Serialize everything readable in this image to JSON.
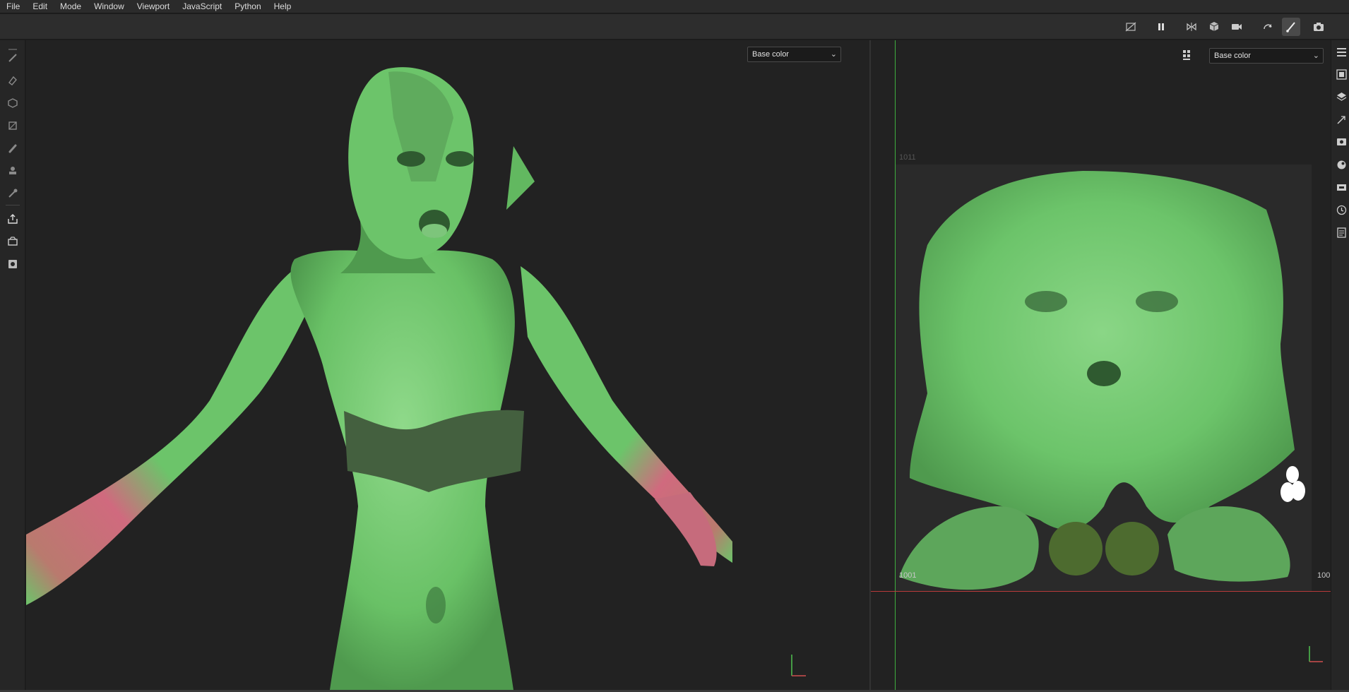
{
  "menu": {
    "items": [
      "File",
      "Edit",
      "Mode",
      "Window",
      "Viewport",
      "JavaScript",
      "Python",
      "Help"
    ]
  },
  "toolbar": {
    "icons": [
      "hide-ui-icon",
      "pause-icon",
      "symmetry-icon",
      "cube-icon",
      "camera-icon",
      "rotate-icon",
      "paint-brush-icon",
      "screenshot-icon"
    ]
  },
  "left_tools": [
    "paint-icon",
    "eraser-icon",
    "projection-icon",
    "polygon-fill-icon",
    "smudge-icon",
    "clone-icon",
    "color-picker-icon",
    "export-icon",
    "bake-icon",
    "render-icon"
  ],
  "right_tools": [
    "layers-list-icon",
    "texture-set-icon",
    "layers-icon",
    "properties-icon",
    "display-settings-icon",
    "shader-icon",
    "shelf-icon",
    "history-icon",
    "log-icon"
  ],
  "viewport3d": {
    "channel_select": "Base color"
  },
  "viewport2d": {
    "channel_select": "Base color",
    "uv_tile_top": "1011",
    "uv_tile_bottom": "1001",
    "uv_tile_right": "100"
  },
  "colors": {
    "skin": "#6cc46a",
    "skin_dark": "#3f7a40",
    "band": "#44603f",
    "arm_pink": "#d06a7e",
    "uv_bg": "#2a2a2a"
  }
}
